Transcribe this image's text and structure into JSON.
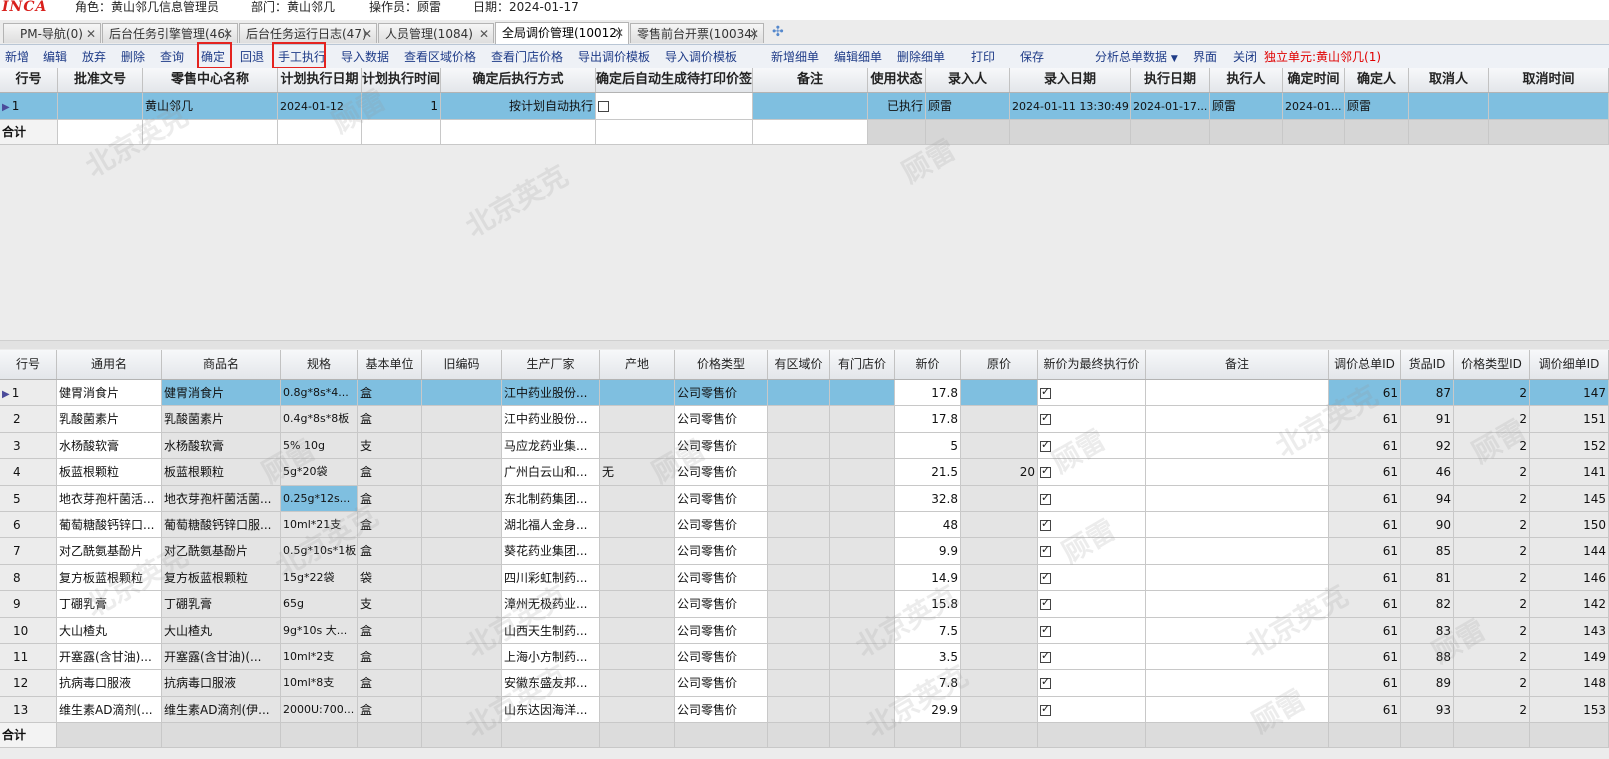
{
  "topbar": {
    "logo": "INCA",
    "role": "角色：黄山邻几信息管理员",
    "dept": "部门：黄山邻几",
    "operator": "操作员：顾雷",
    "date": "日期：2024-01-17"
  },
  "tabs": [
    {
      "label": "PM-导航(0)"
    },
    {
      "label": "后台任务引擎管理(46)"
    },
    {
      "label": "后台任务运行日志(47)"
    },
    {
      "label": "人员管理(1084)"
    },
    {
      "label": "全局调价管理(10012)"
    },
    {
      "label": "零售前台开票(10034)"
    }
  ],
  "toolbar": {
    "buttons": [
      "新增",
      "编辑",
      "放弃",
      "删除",
      "查询",
      "确定",
      "回退",
      "手工执行",
      "导入数据",
      "查看区域价格",
      "查看门店价格",
      "导出调价模板",
      "导入调价模板",
      "新增细单",
      "编辑细单",
      "删除细单",
      "打印",
      "保存",
      "分析总单数据",
      "界面",
      "关闭"
    ],
    "unit_label": "独立单元:黄山邻几(1)"
  },
  "master": {
    "headers": [
      "行号",
      "批准文号",
      "零售中心名称",
      "计划执行日期",
      "计划执行时间",
      "确定后执行方式",
      "确定后自动生成待打印价签",
      "备注",
      "使用状态",
      "录入人",
      "录入日期",
      "执行日期",
      "执行人",
      "确定时间",
      "确定人",
      "取消人",
      "取消时间"
    ],
    "row": {
      "line": "1",
      "approval_no": "",
      "center_name": "黄山邻几",
      "plan_date": "2024-01-12",
      "plan_time": "1",
      "exec_mode": "按计划自动执行",
      "auto_label": false,
      "remark": "",
      "status": "已执行",
      "entered_by": "顾雷",
      "entry_date": "2024-01-11 13:30:49",
      "exec_date": "2024-01-17...",
      "executor": "顾雷",
      "confirm_time": "2024-01...",
      "confirmed_by": "顾雷",
      "cancelled_by": "",
      "cancel_time": ""
    },
    "total_label": "合计"
  },
  "detail": {
    "headers": [
      "行号",
      "通用名",
      "商品名",
      "规格",
      "基本单位",
      "旧编码",
      "生产厂家",
      "产地",
      "价格类型",
      "有区域价",
      "有门店价",
      "新价",
      "原价",
      "新价为最终执行价",
      "备注",
      "调价总单ID",
      "货品ID",
      "价格类型ID",
      "调价细单ID"
    ],
    "rows": [
      {
        "no": "1",
        "generic": "健胃消食片",
        "name": "健胃消食片",
        "spec": "0.8g*8s*4...",
        "unit": "盒",
        "oldcode": "",
        "maker": "江中药业股份...",
        "origin": "",
        "ptype": "公司零售价",
        "new": "17.8",
        "orig": "",
        "final": true,
        "remark": "",
        "mid": "61",
        "gid": "87",
        "tid": "2",
        "did": "147"
      },
      {
        "no": "2",
        "generic": "乳酸菌素片",
        "name": "乳酸菌素片",
        "spec": "0.4g*8s*8板",
        "unit": "盒",
        "oldcode": "",
        "maker": "江中药业股份...",
        "origin": "",
        "ptype": "公司零售价",
        "new": "17.8",
        "orig": "",
        "final": true,
        "remark": "",
        "mid": "61",
        "gid": "91",
        "tid": "2",
        "did": "151"
      },
      {
        "no": "3",
        "generic": "水杨酸软膏",
        "name": "水杨酸软膏",
        "spec": "5% 10g",
        "unit": "支",
        "oldcode": "",
        "maker": "马应龙药业集...",
        "origin": "",
        "ptype": "公司零售价",
        "new": "5",
        "orig": "",
        "final": true,
        "remark": "",
        "mid": "61",
        "gid": "92",
        "tid": "2",
        "did": "152"
      },
      {
        "no": "4",
        "generic": "板蓝根颗粒",
        "name": "板蓝根颗粒",
        "spec": "5g*20袋",
        "unit": "盒",
        "oldcode": "",
        "maker": "广州白云山和...",
        "origin": "无",
        "ptype": "公司零售价",
        "new": "21.5",
        "orig": "20",
        "final": true,
        "remark": "",
        "mid": "61",
        "gid": "46",
        "tid": "2",
        "did": "141"
      },
      {
        "no": "5",
        "generic": "地衣芽孢杆菌活...",
        "name": "地衣芽孢杆菌活菌...",
        "spec": "0.25g*12s...",
        "unit": "盒",
        "oldcode": "",
        "maker": "东北制药集团...",
        "origin": "",
        "ptype": "公司零售价",
        "new": "32.8",
        "orig": "",
        "final": true,
        "remark": "",
        "mid": "61",
        "gid": "94",
        "tid": "2",
        "did": "145"
      },
      {
        "no": "6",
        "generic": "葡萄糖酸钙锌口...",
        "name": "葡萄糖酸钙锌口服...",
        "spec": "10ml*21支",
        "unit": "盒",
        "oldcode": "",
        "maker": "湖北福人金身...",
        "origin": "",
        "ptype": "公司零售价",
        "new": "48",
        "orig": "",
        "final": true,
        "remark": "",
        "mid": "61",
        "gid": "90",
        "tid": "2",
        "did": "150"
      },
      {
        "no": "7",
        "generic": "对乙酰氨基酚片",
        "name": "对乙酰氨基酚片",
        "spec": "0.5g*10s*1板",
        "unit": "盒",
        "oldcode": "",
        "maker": "葵花药业集团...",
        "origin": "",
        "ptype": "公司零售价",
        "new": "9.9",
        "orig": "",
        "final": true,
        "remark": "",
        "mid": "61",
        "gid": "85",
        "tid": "2",
        "did": "144"
      },
      {
        "no": "8",
        "generic": "复方板蓝根颗粒",
        "name": "复方板蓝根颗粒",
        "spec": "15g*22袋",
        "unit": "袋",
        "oldcode": "",
        "maker": "四川彩虹制药...",
        "origin": "",
        "ptype": "公司零售价",
        "new": "14.9",
        "orig": "",
        "final": true,
        "remark": "",
        "mid": "61",
        "gid": "81",
        "tid": "2",
        "did": "146"
      },
      {
        "no": "9",
        "generic": "丁硼乳膏",
        "name": "丁硼乳膏",
        "spec": "65g",
        "unit": "支",
        "oldcode": "",
        "maker": "漳州无极药业...",
        "origin": "",
        "ptype": "公司零售价",
        "new": "15.8",
        "orig": "",
        "final": true,
        "remark": "",
        "mid": "61",
        "gid": "82",
        "tid": "2",
        "did": "142"
      },
      {
        "no": "10",
        "generic": "大山楂丸",
        "name": "大山楂丸",
        "spec": "9g*10s 大...",
        "unit": "盒",
        "oldcode": "",
        "maker": "山西天生制药...",
        "origin": "",
        "ptype": "公司零售价",
        "new": "7.5",
        "orig": "",
        "final": true,
        "remark": "",
        "mid": "61",
        "gid": "83",
        "tid": "2",
        "did": "143"
      },
      {
        "no": "11",
        "generic": "开塞露(含甘油)...",
        "name": "开塞露(含甘油)(...",
        "spec": "10ml*2支",
        "unit": "盒",
        "oldcode": "",
        "maker": "上海小方制药...",
        "origin": "",
        "ptype": "公司零售价",
        "new": "3.5",
        "orig": "",
        "final": true,
        "remark": "",
        "mid": "61",
        "gid": "88",
        "tid": "2",
        "did": "149"
      },
      {
        "no": "12",
        "generic": "抗病毒口服液",
        "name": "抗病毒口服液",
        "spec": "10ml*8支",
        "unit": "盒",
        "oldcode": "",
        "maker": "安徽东盛友邦...",
        "origin": "",
        "ptype": "公司零售价",
        "new": "7.8",
        "orig": "",
        "final": true,
        "remark": "",
        "mid": "61",
        "gid": "89",
        "tid": "2",
        "did": "148"
      },
      {
        "no": "13",
        "generic": "维生素AD滴剂(...",
        "name": "维生素AD滴剂(伊...",
        "spec": "2000U:700...",
        "unit": "盒",
        "oldcode": "",
        "maker": "山东达因海洋...",
        "origin": "",
        "ptype": "公司零售价",
        "new": "29.9",
        "orig": "",
        "final": true,
        "remark": "",
        "mid": "61",
        "gid": "93",
        "tid": "2",
        "did": "153"
      }
    ],
    "total_label": "合计"
  },
  "watermark": [
    "北京英克",
    "顾雷"
  ],
  "colors": {
    "selected": "#7fbfe0",
    "accent": "#1f3c88",
    "warn": "#e00000",
    "highlight_box": "#e4231f"
  }
}
